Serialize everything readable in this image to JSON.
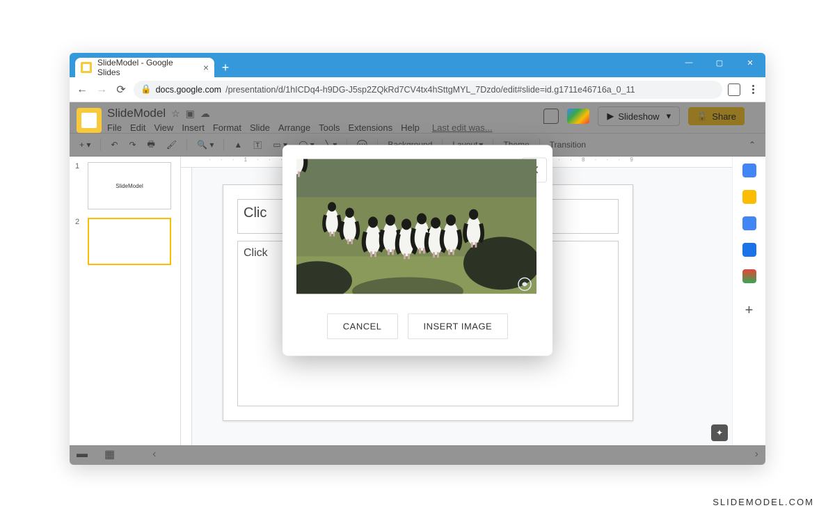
{
  "browser": {
    "tab_title": "SlideModel - Google Slides",
    "url_host": "docs.google.com",
    "url_path": "/presentation/d/1hICDq4-h9DG-J5sp2ZQkRd7CV4tx4hSttgMYL_7Dzdo/edit#slide=id.g1711e46716a_0_11"
  },
  "app": {
    "doc_title": "SlideModel",
    "menus": [
      "File",
      "Edit",
      "View",
      "Insert",
      "Format",
      "Slide",
      "Arrange",
      "Tools",
      "Extensions",
      "Help"
    ],
    "last_edit": "Last edit was...",
    "slideshow_label": "Slideshow",
    "share_label": "Share"
  },
  "toolbar": {
    "background": "Background",
    "layout": "Layout",
    "theme": "Theme",
    "transition": "Transition"
  },
  "thumbs": [
    {
      "num": "1",
      "label": "SlideModel"
    },
    {
      "num": "2",
      "label": ""
    }
  ],
  "slide": {
    "ph1": "Clic",
    "ph2": "Click"
  },
  "modal": {
    "cancel": "CANCEL",
    "insert": "INSERT IMAGE"
  },
  "watermark": "SLIDEMODEL.COM"
}
